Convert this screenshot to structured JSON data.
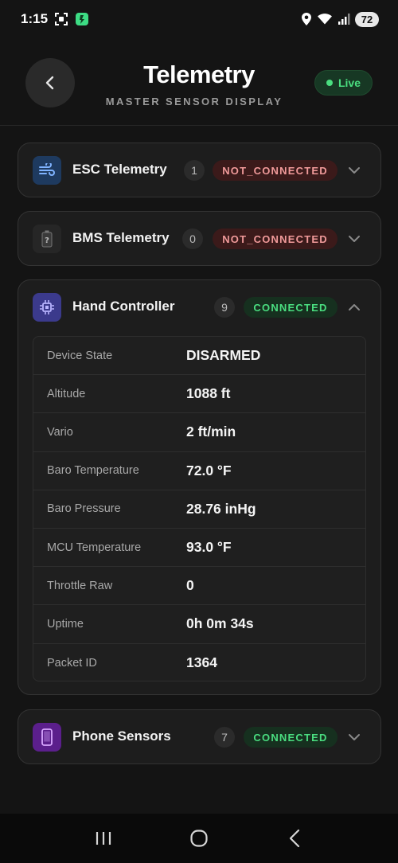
{
  "status_bar": {
    "time": "1:15",
    "battery": "72"
  },
  "header": {
    "title": "Telemetry",
    "subtitle": "MASTER SENSOR DISPLAY",
    "live_label": "Live"
  },
  "cards": {
    "esc": {
      "title": "ESC Telemetry",
      "count": "1",
      "state": "NOT_CONNECTED",
      "icon": "fan-wind-icon",
      "expanded": false
    },
    "bms": {
      "title": "BMS Telemetry",
      "count": "0",
      "state": "NOT_CONNECTED",
      "icon": "battery-unknown-icon",
      "expanded": false
    },
    "hand": {
      "title": "Hand Controller",
      "count": "9",
      "state": "CONNECTED",
      "icon": "chip-icon",
      "expanded": true,
      "rows": [
        {
          "label": "Device State",
          "value": "DISARMED"
        },
        {
          "label": "Altitude",
          "value": "1088 ft"
        },
        {
          "label": "Vario",
          "value": "2 ft/min"
        },
        {
          "label": "Baro Temperature",
          "value": "72.0 °F"
        },
        {
          "label": "Baro Pressure",
          "value": "28.76 inHg"
        },
        {
          "label": "MCU Temperature",
          "value": "93.0 °F"
        },
        {
          "label": "Throttle Raw",
          "value": "0"
        },
        {
          "label": "Uptime",
          "value": "0h 0m 34s"
        },
        {
          "label": "Packet ID",
          "value": "1364"
        }
      ]
    },
    "phone": {
      "title": "Phone Sensors",
      "count": "7",
      "state": "CONNECTED",
      "icon": "phone-icon",
      "expanded": false
    }
  },
  "colors": {
    "background": "#141414",
    "card": "#1d1d1d",
    "connected": "#4ade80",
    "not_connected": "#f09a9a",
    "esc_icon_bg": "#1e3a5f",
    "hand_icon_bg": "#3b3a8c",
    "phone_icon_bg": "#5b1f8c"
  }
}
